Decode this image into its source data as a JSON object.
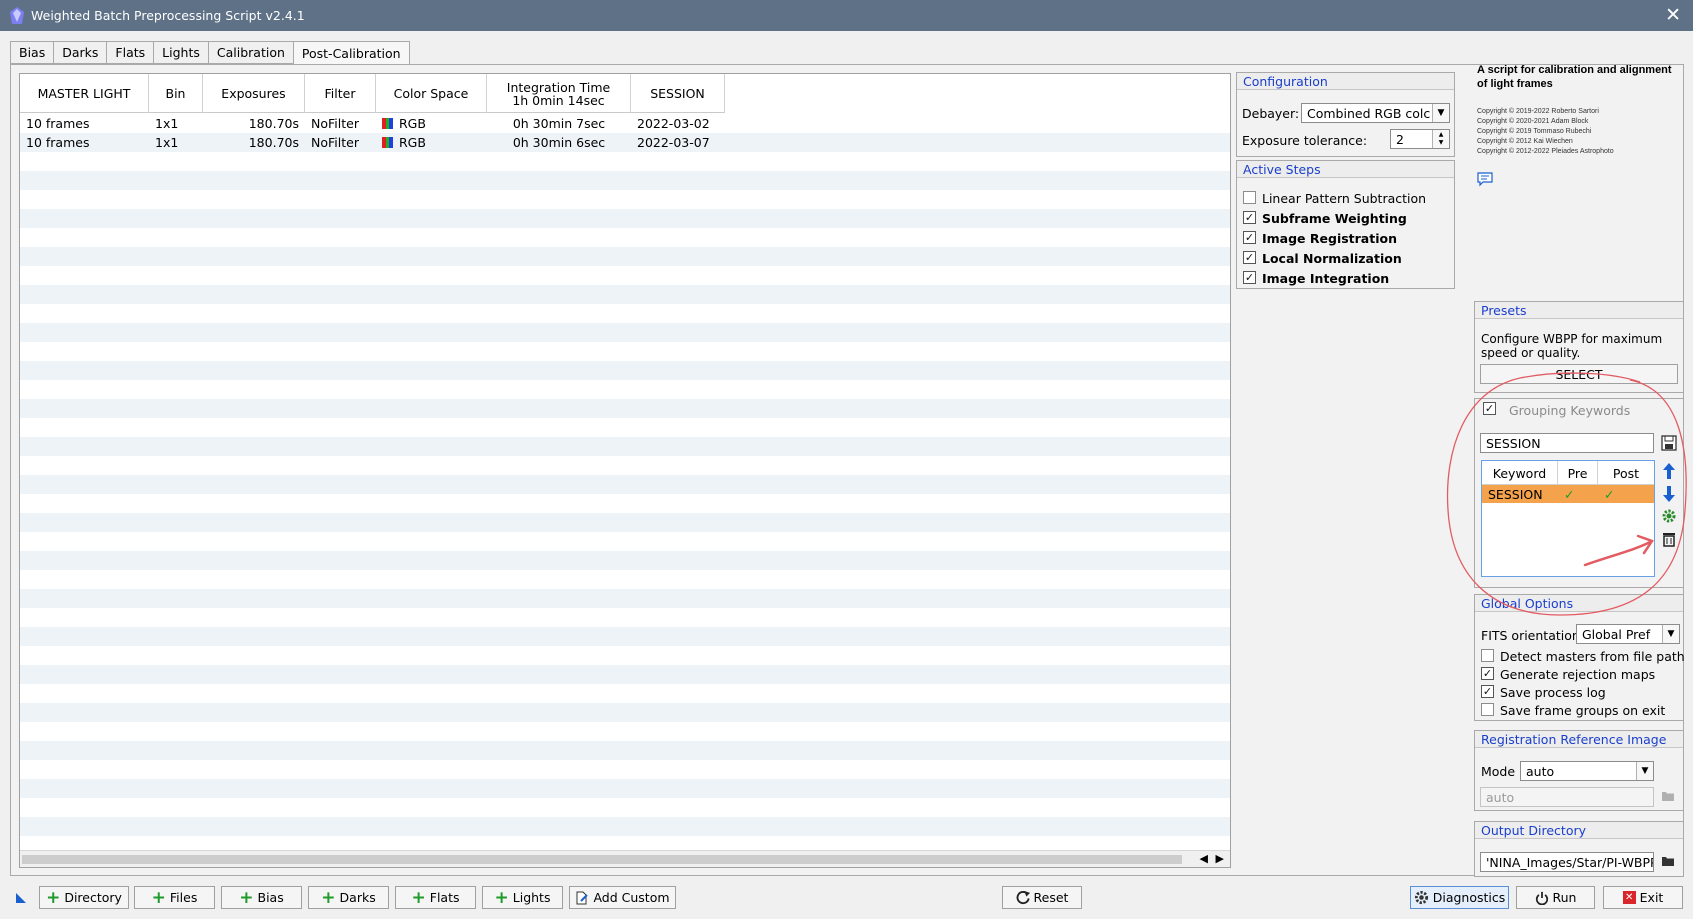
{
  "window": {
    "title": "Weighted Batch Preprocessing Script v2.4.1",
    "close_glyph": "✕"
  },
  "tabs": [
    "Bias",
    "Darks",
    "Flats",
    "Lights",
    "Calibration",
    "Post-Calibration"
  ],
  "active_tab": "Post-Calibration",
  "table": {
    "columns": [
      "MASTER LIGHT",
      "Bin",
      "Exposures",
      "Filter",
      "Color Space",
      "Integration Time\n1h  0min 14sec",
      "SESSION"
    ],
    "rows": [
      {
        "master": "10 frames",
        "bin": "1x1",
        "exposures": "180.70s",
        "filter": "NoFilter",
        "color_space": "RGB",
        "integration": "0h 30min  7sec",
        "session": "2022-03-02"
      },
      {
        "master": "10 frames",
        "bin": "1x1",
        "exposures": "180.70s",
        "filter": "NoFilter",
        "color_space": "RGB",
        "integration": "0h 30min  6sec",
        "session": "2022-03-07"
      }
    ]
  },
  "configuration": {
    "title": "Configuration",
    "debayer_label": "Debayer:",
    "debayer_value": "Combined RGB colc",
    "exposure_label": "Exposure tolerance:",
    "exposure_value": "2"
  },
  "active_steps": {
    "title": "Active  Steps",
    "items": [
      {
        "label": "Linear Pattern Subtraction",
        "checked": false
      },
      {
        "label": "Subframe Weighting",
        "checked": true
      },
      {
        "label": "Image Registration",
        "checked": true
      },
      {
        "label": "Local Normalization",
        "checked": true
      },
      {
        "label": "Image Integration",
        "checked": true
      }
    ]
  },
  "about": {
    "heading": "A script for calibration and alignment of light frames",
    "copyrights": [
      "Copyright © 2019-2022 Roberto Sartori",
      "Copyright © 2020-2021 Adam Block",
      "Copyright © 2019 Tommaso Rubechi",
      "Copyright © 2012 Kai Wiechen",
      "Copyright © 2012-2022 Pleiades Astrophoto"
    ]
  },
  "presets": {
    "title": "Presets",
    "description": "Configure WBPP for maximum speed or quality.",
    "select_label": "SELECT"
  },
  "grouping": {
    "title": "Grouping Keywords",
    "enabled": true,
    "keyword_input": "SESSION",
    "columns": [
      "Keyword",
      "Pre",
      "Post"
    ],
    "rows": [
      {
        "keyword": "SESSION",
        "pre": "✓",
        "post": "✓"
      }
    ]
  },
  "global_options": {
    "title": "Global Options",
    "fits_label": "FITS orientation",
    "fits_value": "Global Pref",
    "items": [
      {
        "label": "Detect masters from file path",
        "checked": false
      },
      {
        "label": "Generate rejection maps",
        "checked": true
      },
      {
        "label": "Save process log",
        "checked": true
      },
      {
        "label": "Save frame groups on exit",
        "checked": false
      }
    ]
  },
  "registration": {
    "title": "Registration Reference Image",
    "mode_label": "Mode",
    "mode_value": "auto",
    "ref_value": "auto"
  },
  "output": {
    "title": "Output Directory",
    "path": "'NINA_Images/Star/PI-WBPP"
  },
  "bottom_buttons": {
    "directory": "Directory",
    "files": "Files",
    "bias": "Bias",
    "darks": "Darks",
    "flats": "Flats",
    "lights": "Lights",
    "add_custom": "Add Custom",
    "reset": "Reset",
    "diagnostics": "Diagnostics",
    "run": "Run",
    "exit": "Exit"
  },
  "colors": {
    "titlebar": "#5e7187",
    "panel_title": "#1a3ecc",
    "selected_row": "#f4a24b",
    "check_green": "#1e9b2a",
    "annotation_red": "#e35b63",
    "exit_red": "#d8262b",
    "arrow_blue": "#1a5fd0"
  }
}
